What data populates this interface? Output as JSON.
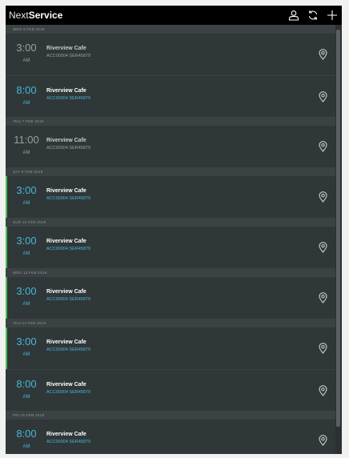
{
  "app": {
    "brand_part1": "Next",
    "brand_part2": "Service"
  },
  "header": {
    "icons": [
      "profile-icon",
      "sync-icon",
      "add-icon"
    ]
  },
  "colors": {
    "header_bg": "#000000",
    "list_bg": "#303738",
    "day_bar_bg": "#3b4243",
    "accent_blue": "#45b7d9",
    "status_green": "#47c04f",
    "muted_text": "#97a0a3"
  },
  "schedule": [
    {
      "date": "WED 6 FEB 2019",
      "jobs": [
        {
          "time": "3:00",
          "ampm": "AM",
          "customer": "Riverview Cafe",
          "ref": "ACC00004 SER45879",
          "state": "past",
          "flag": false
        },
        {
          "time": "8:00",
          "ampm": "AM",
          "customer": "Riverview Cafe",
          "ref": "ACC00004 SER45879",
          "state": "future",
          "flag": false
        }
      ]
    },
    {
      "date": "THU 7 FEB 2019",
      "jobs": [
        {
          "time": "11:00",
          "ampm": "AM",
          "customer": "Riverview Cafe",
          "ref": "ACC00004 SER45879",
          "state": "past",
          "flag": false
        }
      ]
    },
    {
      "date": "SAT 9 FEB 2019",
      "jobs": [
        {
          "time": "3:00",
          "ampm": "AM",
          "customer": "Riverview Cafe",
          "ref": "ACC00004 SER45879",
          "state": "future",
          "flag": true
        }
      ]
    },
    {
      "date": "SUN 10 FEB 2019",
      "jobs": [
        {
          "time": "3:00",
          "ampm": "AM",
          "customer": "Riverview Cafe",
          "ref": "ACC00004 SER45879",
          "state": "future",
          "flag": true
        }
      ]
    },
    {
      "date": "WED 13 FEB 2019",
      "jobs": [
        {
          "time": "3:00",
          "ampm": "AM",
          "customer": "Riverview Cafe",
          "ref": "ACC00004 SER45879",
          "state": "future",
          "flag": true
        }
      ]
    },
    {
      "date": "THU 14 FEB 2019",
      "jobs": [
        {
          "time": "3:00",
          "ampm": "AM",
          "customer": "Riverview Cafe",
          "ref": "ACC00004 SER45879",
          "state": "future",
          "flag": true
        },
        {
          "time": "8:00",
          "ampm": "AM",
          "customer": "Riverview Cafe",
          "ref": "ACC00004 SER45879",
          "state": "future",
          "flag": false
        }
      ]
    },
    {
      "date": "FRI 15 FEB 2019",
      "jobs": [
        {
          "time": "8:00",
          "ampm": "AM",
          "customer": "Riverview Cafe",
          "ref": "ACC00004 SER45879",
          "state": "future",
          "flag": false
        }
      ]
    }
  ]
}
